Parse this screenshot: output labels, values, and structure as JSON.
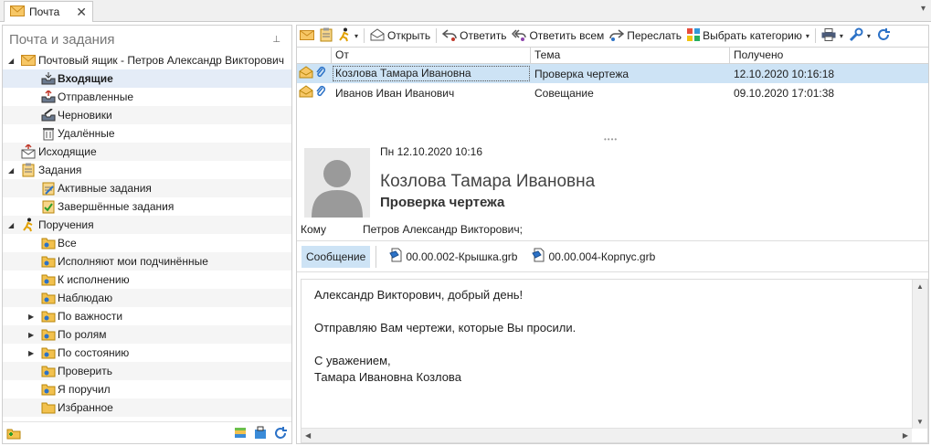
{
  "tab": {
    "label": "Почта",
    "close": "✕",
    "menu": "▾"
  },
  "left_panel": {
    "title": "Почта и задания",
    "pin": "⊥",
    "tree": [
      {
        "level": 0,
        "expander": "◢",
        "icon": "mail-icon",
        "label": "Почтовый ящик - Петров Александр Викторович",
        "selected": false
      },
      {
        "level": 1,
        "expander": "",
        "icon": "inbox-icon",
        "label": "Входящие",
        "selected": true
      },
      {
        "level": 1,
        "expander": "",
        "icon": "sent-icon",
        "label": "Отправленные",
        "selected": false
      },
      {
        "level": 1,
        "expander": "",
        "icon": "drafts-icon",
        "label": "Черновики",
        "selected": false
      },
      {
        "level": 1,
        "expander": "",
        "icon": "trash-icon",
        "label": "Удалённые",
        "selected": false
      },
      {
        "level": 0,
        "expander": "",
        "icon": "outbox-icon",
        "label": "Исходящие",
        "selected": false
      },
      {
        "level": 0,
        "expander": "◢",
        "icon": "tasks-icon",
        "label": "Задания",
        "selected": false
      },
      {
        "level": 1,
        "expander": "",
        "icon": "active-tasks-icon",
        "label": "Активные задания",
        "selected": false
      },
      {
        "level": 1,
        "expander": "",
        "icon": "done-tasks-icon",
        "label": "Завершённые задания",
        "selected": false
      },
      {
        "level": 0,
        "expander": "◢",
        "icon": "assignments-icon",
        "label": "Поручения",
        "selected": false
      },
      {
        "level": 1,
        "expander": "",
        "icon": "folder-icon",
        "label": "Все",
        "selected": false
      },
      {
        "level": 1,
        "expander": "",
        "icon": "folder-icon",
        "label": "Исполняют мои подчинённые",
        "selected": false
      },
      {
        "level": 1,
        "expander": "",
        "icon": "folder-icon",
        "label": "К исполнению",
        "selected": false
      },
      {
        "level": 1,
        "expander": "",
        "icon": "folder-icon",
        "label": "Наблюдаю",
        "selected": false
      },
      {
        "level": 1,
        "expander": "▶",
        "icon": "folder-icon",
        "label": "По важности",
        "selected": false
      },
      {
        "level": 1,
        "expander": "▶",
        "icon": "folder-icon",
        "label": "По ролям",
        "selected": false
      },
      {
        "level": 1,
        "expander": "▶",
        "icon": "folder-icon",
        "label": "По состоянию",
        "selected": false
      },
      {
        "level": 1,
        "expander": "",
        "icon": "folder-icon",
        "label": "Проверить",
        "selected": false
      },
      {
        "level": 1,
        "expander": "",
        "icon": "folder-icon",
        "label": "Я поручил",
        "selected": false
      },
      {
        "level": 1,
        "expander": "",
        "icon": "star-folder-icon",
        "label": "Избранное",
        "selected": false
      }
    ]
  },
  "toolbar": {
    "open_label": "Открыть",
    "reply_label": "Ответить",
    "reply_all_label": "Ответить всем",
    "forward_label": "Переслать",
    "category_label": "Выбрать категорию",
    "dropdown_glyph": "▾"
  },
  "grid": {
    "columns": [
      "От",
      "Тема",
      "Получено"
    ],
    "rows": [
      {
        "from": "Козлова Тамара Ивановна",
        "subject": "Проверка чертежа",
        "received": "12.10.2020 10:16:18",
        "selected": true
      },
      {
        "from": "Иванов Иван Иванович",
        "subject": "Совещание",
        "received": "09.10.2020 17:01:38",
        "selected": false
      }
    ],
    "splitter": "••••"
  },
  "preview": {
    "date": "Пн 12.10.2020 10:16",
    "sender": "Козлова Тамара Ивановна",
    "subject": "Проверка чертежа",
    "to_label": "Кому",
    "to_value": "Петров Александр Викторович;",
    "message_tab": "Сообщение",
    "attachments": [
      "00.00.002-Крышка.grb",
      "00.00.004-Корпус.grb"
    ],
    "body_lines": [
      "Александр Викторович, добрый день!",
      "",
      "Отправляю Вам чертежи, которые Вы просили.",
      "",
      "С уважением,",
      "Тамара Ивановна Козлова"
    ]
  },
  "scroll": {
    "up": "▲",
    "down": "▼",
    "left": "◀",
    "right": "▶"
  },
  "colors": {
    "accent": "#cde3f5",
    "folder": "#f2c14e",
    "icon_blue": "#2c72c7"
  }
}
